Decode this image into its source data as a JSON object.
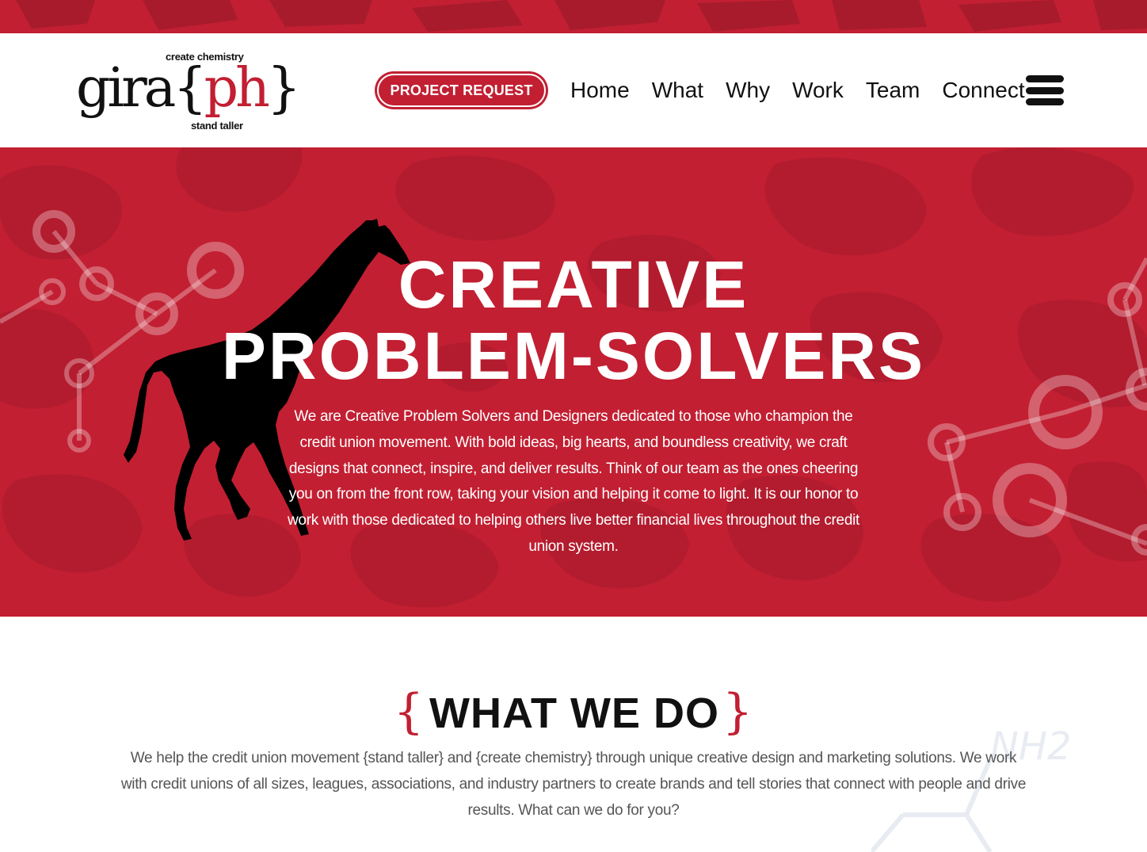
{
  "header": {
    "logo": {
      "tag_top": "create chemistry",
      "word_prefix": "gira",
      "brace_open": "{",
      "word_red": "ph",
      "brace_close": "}",
      "tag_bottom": "stand taller"
    },
    "project_request_label": "PROJECT REQUEST",
    "nav": [
      "Home",
      "What",
      "Why",
      "Work",
      "Team",
      "Connect"
    ],
    "menu_icon": "hamburger-icon"
  },
  "hero": {
    "title_line1": "CREATIVE",
    "title_line2": "PROBLEM-SOLVERS",
    "body": "We are Creative Problem Solvers and Designers dedicated to those who champion the credit union movement. With bold ideas, big hearts, and boundless creativity, we craft designs that connect, inspire, and deliver results. Think of our team as the ones cheering you on from the front row, taking your vision and helping it come to light. It is our honor to work with those dedicated to helping others live better financial lives throughout the credit union system.",
    "illustration": "giraffe-silhouette"
  },
  "what_we_do": {
    "brace_open": "{",
    "title": "WHAT WE DO",
    "brace_close": "}",
    "body": "We help the credit union movement {stand taller} and {create chemistry} through unique creative design and marketing solutions. We work with credit unions of all sizes, leagues, associations, and industry partners to create brands and tell stories that connect with people and drive results. What can we do for you?",
    "decoration_text": "NH2"
  },
  "colors": {
    "brand_red": "#c21f32",
    "dark_red": "#a81b2c",
    "text_dark": "#111111",
    "text_gray": "#555555"
  }
}
